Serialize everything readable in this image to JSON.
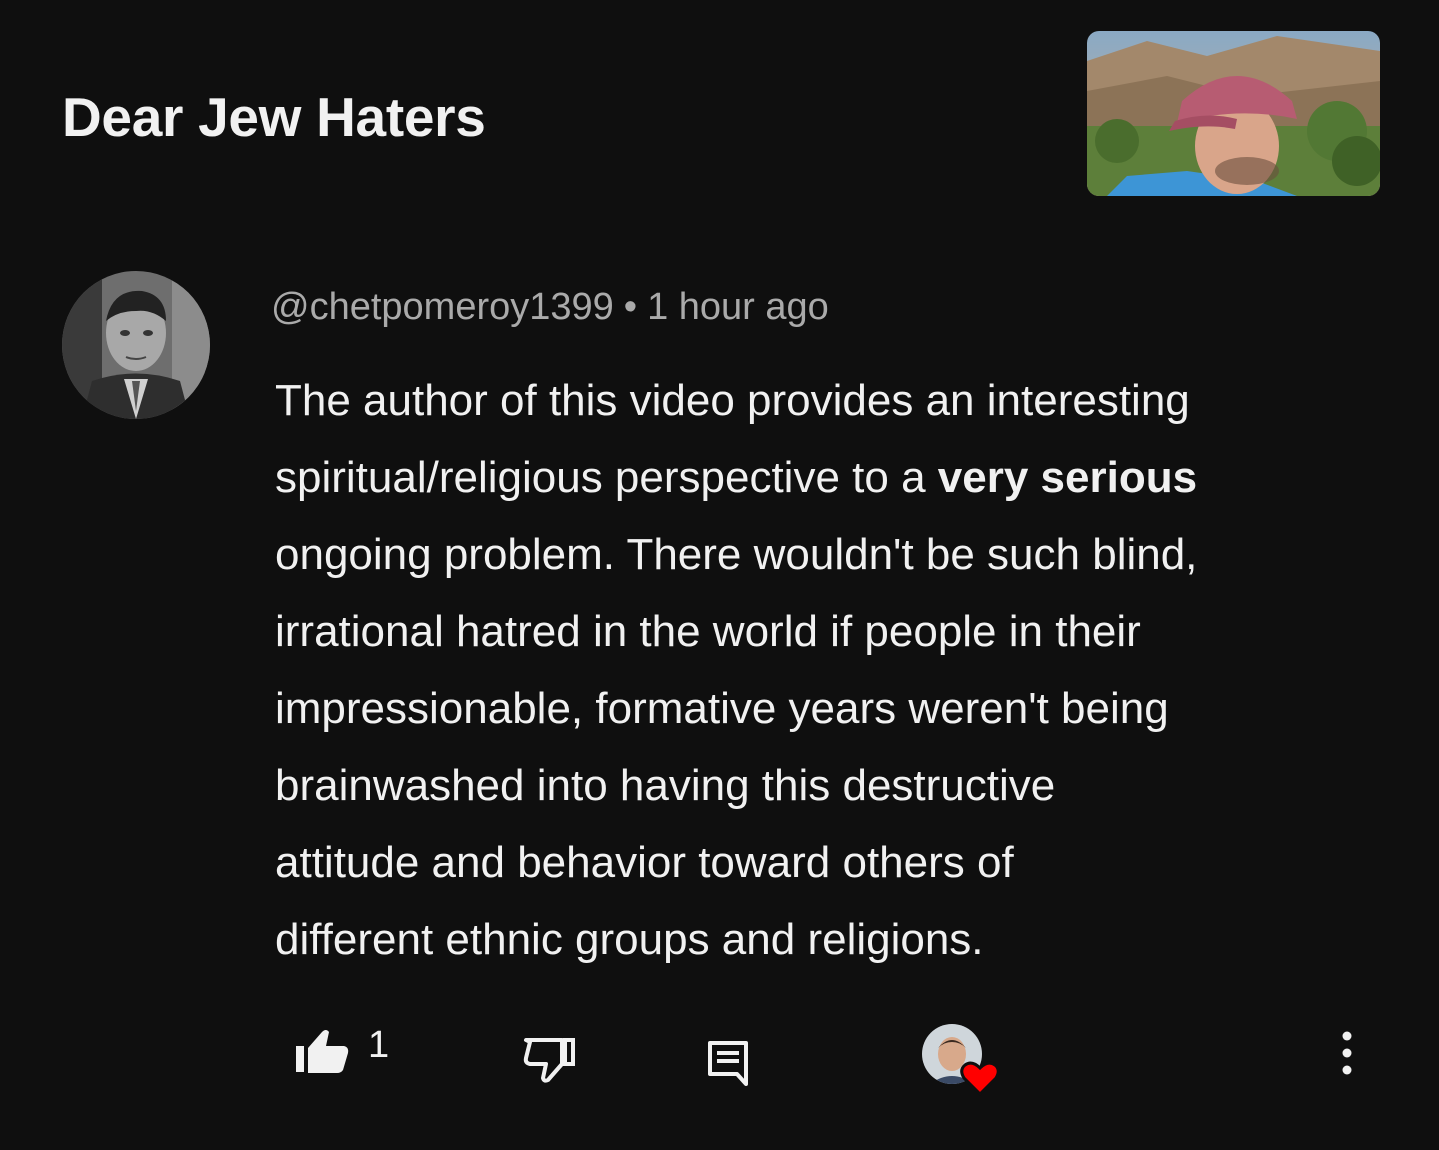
{
  "video": {
    "title": "Dear Jew Haters",
    "thumbnail_icon": "video-thumbnail"
  },
  "comment": {
    "author": "@chetpomeroy1399",
    "separator": "•",
    "timestamp": "1 hour ago",
    "lines": [
      {
        "pre": "The author of this video provides an interesting",
        "bold": "",
        "post": ""
      },
      {
        "pre": "spiritual/religious perspective to a ",
        "bold": "very serious",
        "post": ""
      },
      {
        "pre": "ongoing problem. There wouldn't be such blind,",
        "bold": "",
        "post": ""
      },
      {
        "pre": "irrational hatred in the world if people in their",
        "bold": "",
        "post": ""
      },
      {
        "pre": "impressionable, formative years weren't being",
        "bold": "",
        "post": ""
      },
      {
        "pre": "brainwashed into having this destructive",
        "bold": "",
        "post": ""
      },
      {
        "pre": "attitude and behavior toward others of",
        "bold": "",
        "post": ""
      },
      {
        "pre": "different ethnic groups and religions.",
        "bold": "",
        "post": ""
      }
    ]
  },
  "actions": {
    "like_count": "1",
    "like_icon": "thumbs-up-icon",
    "dislike_icon": "thumbs-down-icon",
    "reply_icon": "reply-icon",
    "heart_icon": "creator-heart-icon",
    "more_icon": "more-vert-icon"
  },
  "colors": {
    "background": "#0f0f0f",
    "text": "#f1f1f1",
    "secondary_text": "#aaaaaa",
    "heart": "#ff0000"
  }
}
